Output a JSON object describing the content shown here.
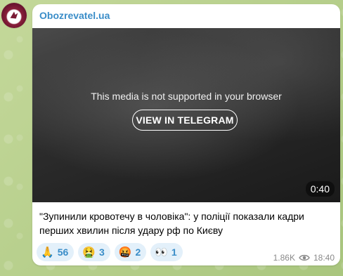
{
  "channel": {
    "name": "Obozrevatel.ua"
  },
  "media": {
    "message": "This media is not supported in your browser",
    "button_label": "VIEW IN TELEGRAM",
    "duration": "0:40"
  },
  "post": {
    "caption": "\"Зупинили кровотечу в чоловіка\": у поліції показали кадри перших хвилин після удару рф по Києву"
  },
  "reactions": [
    {
      "emoji": "🙏",
      "count": "56"
    },
    {
      "emoji": "🤮",
      "count": "3"
    },
    {
      "emoji": "🤬",
      "count": "2"
    },
    {
      "emoji": "👀",
      "count": "1"
    }
  ],
  "meta": {
    "views": "1.86K",
    "time": "18:40",
    "view_icon": "eye-icon"
  },
  "colors": {
    "accent": "#3a8dc8",
    "reaction_bg": "#e3f0fa"
  }
}
